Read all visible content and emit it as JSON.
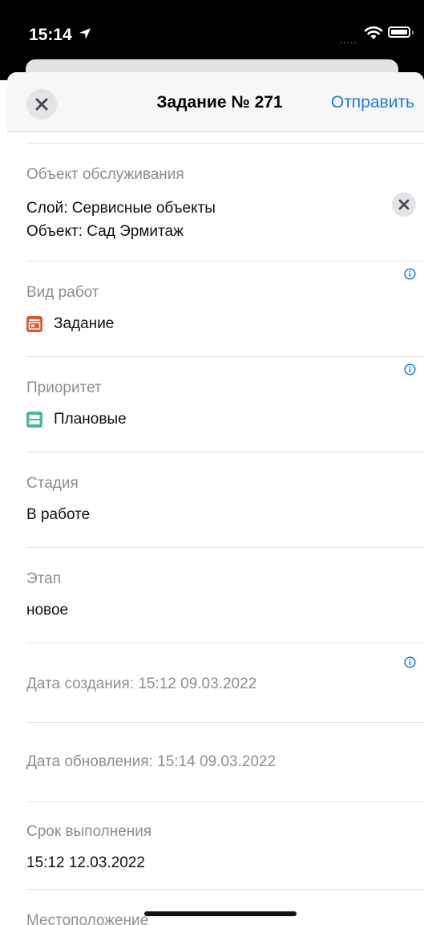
{
  "status_bar": {
    "time": "15:14",
    "signal_text": "....."
  },
  "nav": {
    "title": "Задание № 271",
    "send_label": "Отправить"
  },
  "fields": {
    "service_object": {
      "label": "Объект обслуживания",
      "layer_line": "Слой: Сервисные объекты",
      "object_line": "Объект: Сад Эрмитаж"
    },
    "work_type": {
      "label": "Вид работ",
      "value": "Задание",
      "icon": "task-form-icon",
      "icon_color": "#e2562e"
    },
    "priority": {
      "label": "Приоритет",
      "value": "Плановые",
      "icon": "planned-priority-icon",
      "icon_color": "#4db896"
    },
    "stage": {
      "label": "Стадия",
      "value": "В работе"
    },
    "step": {
      "label": "Этап",
      "value": "новое"
    },
    "created": {
      "text": "Дата создания: 15:12 09.03.2022"
    },
    "updated": {
      "text": "Дата обновления: 15:14 09.03.2022"
    },
    "deadline": {
      "label": "Срок выполнения",
      "value": "15:12 12.03.2022"
    },
    "location": {
      "label": "Местоположение"
    }
  },
  "colors": {
    "accent": "#1a7de0",
    "label_gray": "#8e8e93"
  }
}
